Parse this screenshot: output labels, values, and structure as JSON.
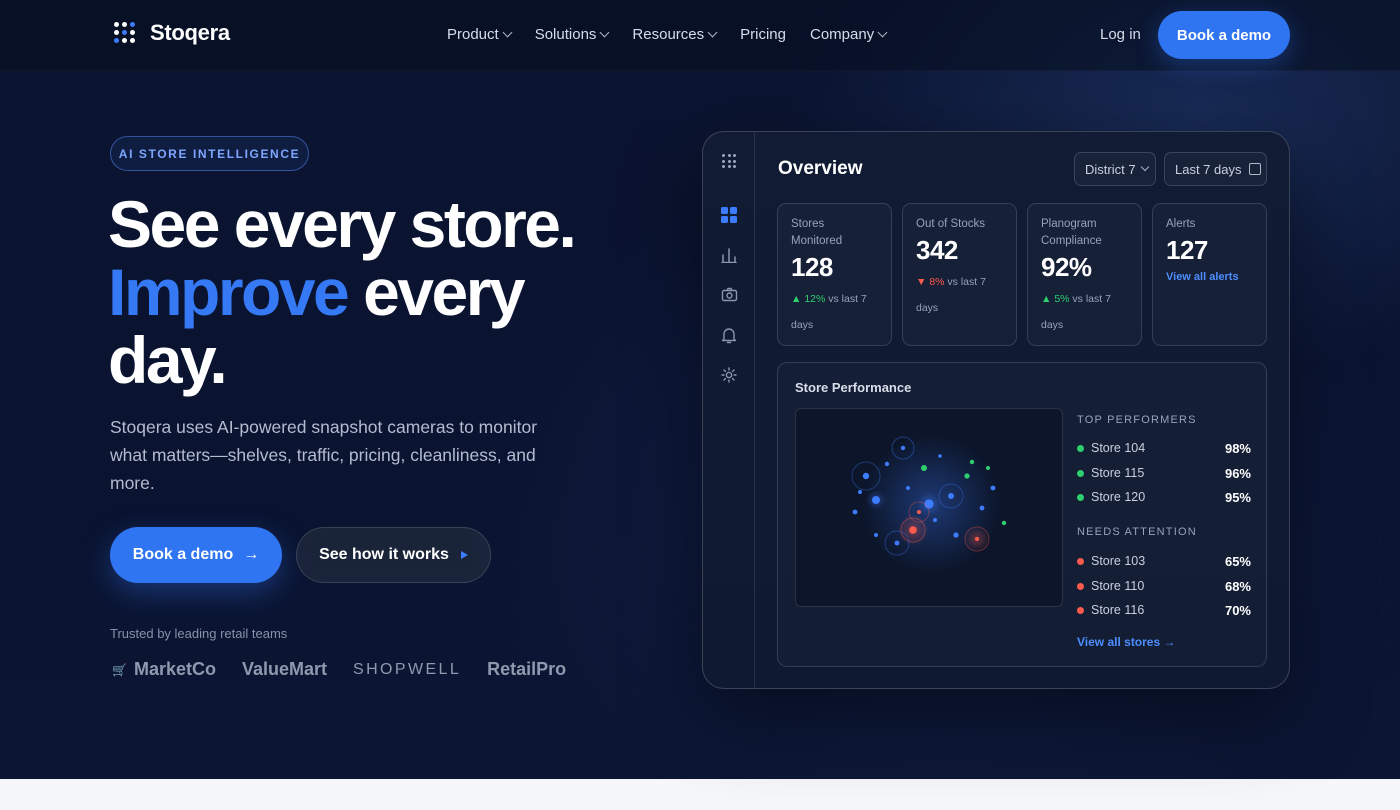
{
  "brand": {
    "name": "Stoqera"
  },
  "nav": {
    "links": [
      {
        "label": "Product",
        "dropdown": true
      },
      {
        "label": "Solutions",
        "dropdown": true
      },
      {
        "label": "Resources",
        "dropdown": true
      },
      {
        "label": "Pricing",
        "dropdown": false
      },
      {
        "label": "Company",
        "dropdown": true
      }
    ],
    "login": "Log in",
    "cta": "Book a demo"
  },
  "hero": {
    "badge": "AI STORE INTELLIGENCE",
    "headline_line1": "See every store.",
    "headline_blue": "Improve",
    "headline_line2_rest": " every",
    "headline_line3": "day.",
    "subtitle": "Stoqera uses AI-powered snapshot cameras to monitor what matters—shelves, traffic, pricing, cleanliness, and more.",
    "primary_cta": "Book a demo",
    "secondary_cta": "See how it works",
    "trusted_label": "Trusted by leading retail teams",
    "brands": [
      "MarketCo",
      "ValueMart",
      "SHOPWELL",
      "RetailPro"
    ]
  },
  "dashboard": {
    "title": "Overview",
    "district_select": "District 7",
    "range_select": "Last 7 days",
    "sidebar_icons": [
      "apps-icon",
      "dashboard-icon",
      "bar-chart-icon",
      "camera-icon",
      "bell-icon",
      "settings-icon"
    ],
    "kpis": [
      {
        "label": "Stores Monitored",
        "value": "128",
        "delta": "12%",
        "delta_dir": "up",
        "delta_suffix": " vs last 7 days"
      },
      {
        "label": "Out of Stocks",
        "value": "342",
        "delta": "8%",
        "delta_dir": "down",
        "delta_suffix": " vs last 7 days"
      },
      {
        "label": "Planogram Compliance",
        "value": "92%",
        "delta": "5%",
        "delta_dir": "up",
        "delta_suffix": " vs last 7 days"
      },
      {
        "label": "Alerts",
        "value": "127",
        "link": "View all alerts"
      }
    ],
    "performance": {
      "title": "Store Performance",
      "top_label": "TOP PERFORMERS",
      "top": [
        {
          "name": "Store 104",
          "pct": "98%"
        },
        {
          "name": "Store 115",
          "pct": "96%"
        },
        {
          "name": "Store 120",
          "pct": "95%"
        }
      ],
      "attention_label": "NEEDS ATTENTION",
      "attention": [
        {
          "name": "Store 103",
          "pct": "65%"
        },
        {
          "name": "Store 110",
          "pct": "68%"
        },
        {
          "name": "Store 116",
          "pct": "70%"
        }
      ],
      "view_all": "View all stores →"
    }
  },
  "colors": {
    "accent": "#2f74f0",
    "accent_text": "#3579f5",
    "good": "#2ed06e",
    "bad": "#ff5a4e",
    "background": "#0a1228"
  }
}
